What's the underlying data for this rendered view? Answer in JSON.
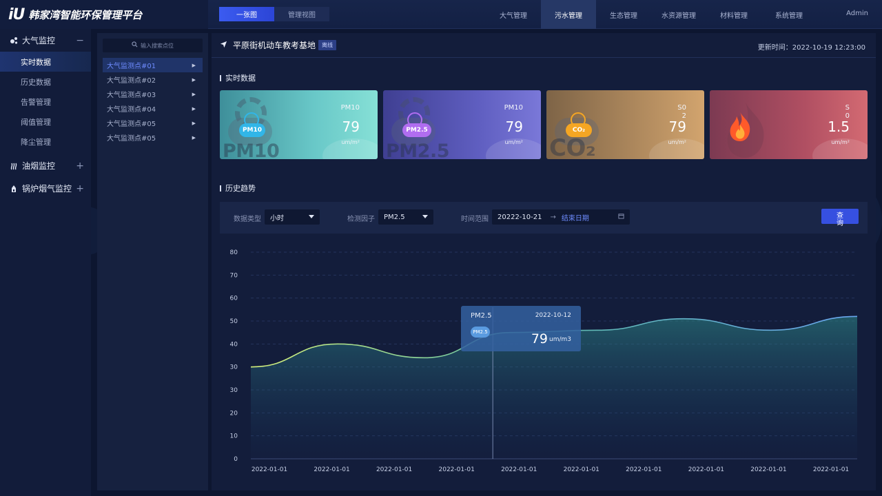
{
  "brand": {
    "logo": "iU",
    "title": "韩家湾智能环保管理平台"
  },
  "view_tabs": [
    {
      "label": "一张图"
    },
    {
      "label": "管理视图"
    }
  ],
  "nav": [
    {
      "label": "大气管理"
    },
    {
      "label": "污水管理"
    },
    {
      "label": "生态管理"
    },
    {
      "label": "水资源管理"
    },
    {
      "label": "材料管理"
    },
    {
      "label": "系统管理"
    }
  ],
  "user": {
    "name": "Admin"
  },
  "sidebar": {
    "groups": [
      {
        "label": "大气监控",
        "toggle": "−"
      },
      {
        "label": "油烟监控",
        "toggle": "+"
      },
      {
        "label": "锅炉烟气监控",
        "toggle": "+"
      }
    ],
    "items": [
      {
        "label": "实时数据"
      },
      {
        "label": "历史数据"
      },
      {
        "label": "告警管理"
      },
      {
        "label": "阈值管理"
      },
      {
        "label": "降尘管理"
      }
    ]
  },
  "stations": {
    "search_placeholder": "输入搜索点位",
    "items": [
      {
        "label": "大气监测点#01"
      },
      {
        "label": "大气监测点#02"
      },
      {
        "label": "大气监测点#03"
      },
      {
        "label": "大气监测点#04"
      },
      {
        "label": "大气监测点#05"
      },
      {
        "label": "大气监测点#05"
      }
    ]
  },
  "site": {
    "name": "平原街机动车教考基地",
    "status": "离线",
    "update_label": "更新时间：",
    "update_time": "2022-10-19 12:23:00"
  },
  "realtime": {
    "title": "实时数据",
    "cards": [
      {
        "label": "PM10",
        "value": "79",
        "unit": "um/m²",
        "bg_text": "PM10",
        "badge": "PM10",
        "color": "#31b6e8"
      },
      {
        "label": "PM10",
        "value": "79",
        "unit": "um/m²",
        "bg_text": "PM2.5",
        "badge": "PM2.5",
        "color": "#b06df0"
      },
      {
        "label": "S0\n2",
        "value": "79",
        "unit": "um/m²",
        "bg_text": "CO₂",
        "badge": "CO₂",
        "color": "#f5a623"
      },
      {
        "label": "S\n0",
        "value": "1.5",
        "unit": "um/m²",
        "bg_text": "",
        "badge": "",
        "color": "#ff5a2a"
      }
    ]
  },
  "history": {
    "title": "历史趋势",
    "filters": {
      "type_label": "数据类型",
      "type_value": "小时",
      "factor_label": "检测因子",
      "factor_value": "PM2.5",
      "range_label": "时间范围",
      "range_start": "20222-10-21",
      "range_sep": "→",
      "range_end": "结束日期",
      "query_label": "查\n询"
    },
    "tooltip": {
      "name": "PM2.5",
      "date": "2022-10-12",
      "value": "79",
      "unit": "um/m3",
      "icon": "PM2.5"
    }
  },
  "chart_data": {
    "type": "area",
    "x": [
      "2022-01-01",
      "2022-01-01",
      "2022-01-01",
      "2022-01-01",
      "2022-01-01",
      "2022-01-01",
      "2022-01-01",
      "2022-01-01",
      "2022-01-01",
      "2022-01-01"
    ],
    "series": [
      {
        "values": [
          30,
          40,
          34,
          45,
          46,
          51,
          46,
          52
        ]
      }
    ],
    "yticks": [
      0,
      10,
      20,
      30,
      30,
      40,
      50,
      60,
      70,
      80
    ],
    "ylim": [
      0,
      80
    ],
    "colors": {
      "line_start": "#d6f07a",
      "line_end": "#6aa6f0",
      "area": "#2e8a8a"
    }
  }
}
